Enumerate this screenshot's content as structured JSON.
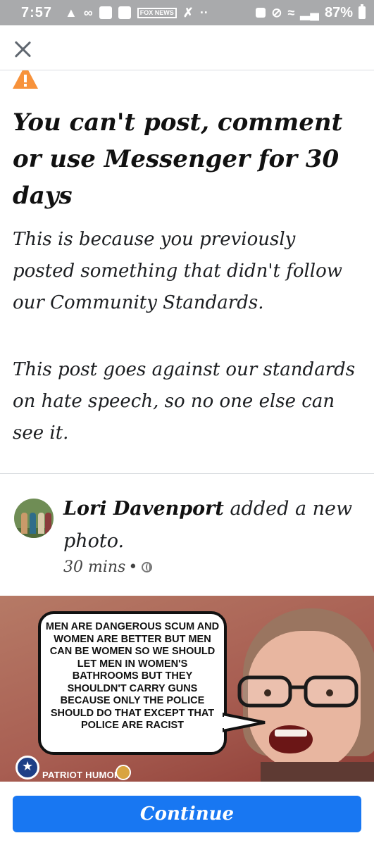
{
  "status_bar": {
    "time": "7:57",
    "battery_level": "87%",
    "icons": [
      "alert-icon",
      "voicemail-icon",
      "app-icon",
      "gallery-icon",
      "fox-news-icon",
      "missed-call-icon",
      "more-icon",
      "nfc-icon",
      "mute-icon",
      "wifi-icon",
      "signal-icon",
      "battery-icon"
    ],
    "fox_news_label": "FOX NEWS"
  },
  "notice": {
    "heading": "You can't post, comment or use Messenger for 30 days",
    "paragraph_1": "This is because you previously posted something that didn't follow our Community Standards.",
    "paragraph_2": "This post goes against our standards on hate speech, so no one else can see it.",
    "warning_color": "#f7923b"
  },
  "post": {
    "author": "Lori Davenport",
    "action": " added a new photo.",
    "time": "30 mins",
    "separator": "•",
    "privacy_icon": "globe-icon"
  },
  "meme": {
    "bubble_text": "Men are dangerous scum and women are better but men can be women so we should let men in women's bathrooms but they shouldn't carry guns because only the police should do that except that police are racist",
    "brand": "PATRIOT HUMOR"
  },
  "continue_label": "Continue",
  "colors": {
    "accent": "#1877f2",
    "status_bar": "#a9aaac"
  }
}
